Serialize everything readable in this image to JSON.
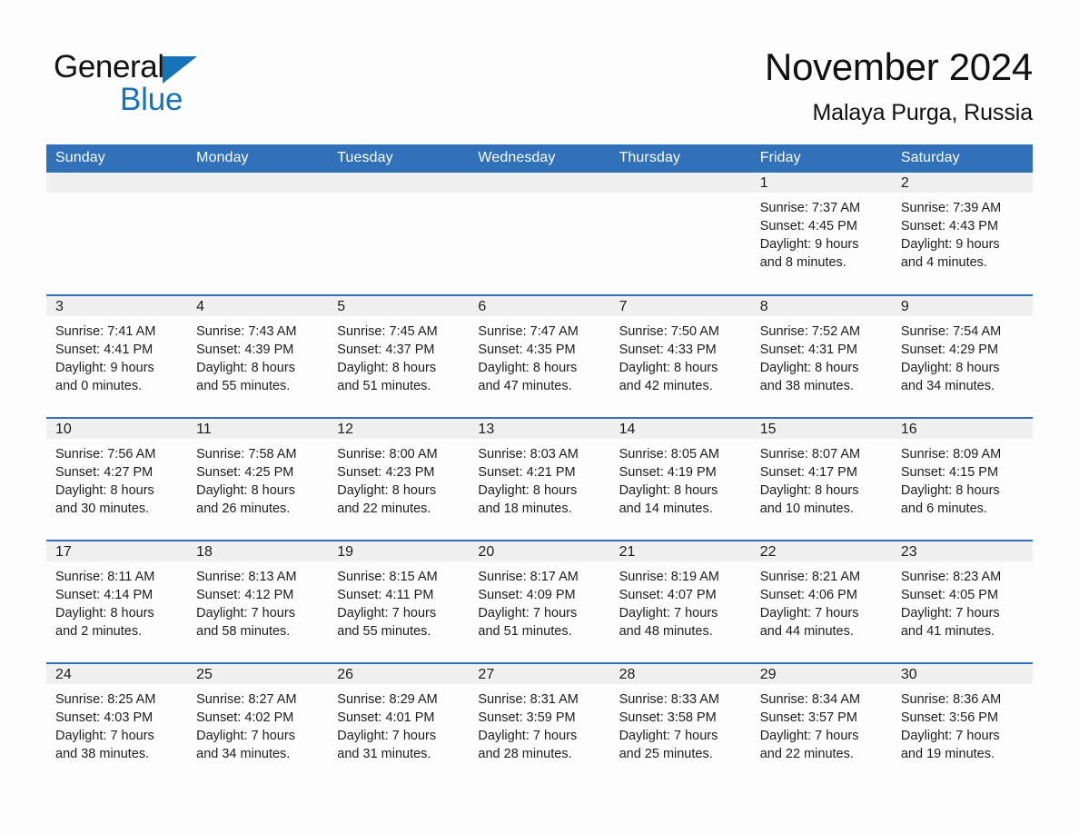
{
  "brand": {
    "name_part1": "General",
    "name_part2": "Blue",
    "triangle_icon": "triangle-icon",
    "accent_color": "#1573ba"
  },
  "header": {
    "title": "November 2024",
    "location": "Malaya Purga, Russia"
  },
  "theme": {
    "header_blue": "#3071b9",
    "daynum_band": "#f0f0f0",
    "page_background": "#fdfdfd",
    "text_color": "#1d1d1d"
  },
  "calendar": {
    "weekday_headers": [
      "Sunday",
      "Monday",
      "Tuesday",
      "Wednesday",
      "Thursday",
      "Friday",
      "Saturday"
    ],
    "weeks": [
      [
        {
          "day": "",
          "sunrise": "",
          "sunset": "",
          "daylight_line1": "",
          "daylight_line2": "",
          "empty": true
        },
        {
          "day": "",
          "sunrise": "",
          "sunset": "",
          "daylight_line1": "",
          "daylight_line2": "",
          "empty": true
        },
        {
          "day": "",
          "sunrise": "",
          "sunset": "",
          "daylight_line1": "",
          "daylight_line2": "",
          "empty": true
        },
        {
          "day": "",
          "sunrise": "",
          "sunset": "",
          "daylight_line1": "",
          "daylight_line2": "",
          "empty": true
        },
        {
          "day": "",
          "sunrise": "",
          "sunset": "",
          "daylight_line1": "",
          "daylight_line2": "",
          "empty": true
        },
        {
          "day": "1",
          "sunrise": "Sunrise: 7:37 AM",
          "sunset": "Sunset: 4:45 PM",
          "daylight_line1": "Daylight: 9 hours",
          "daylight_line2": "and 8 minutes."
        },
        {
          "day": "2",
          "sunrise": "Sunrise: 7:39 AM",
          "sunset": "Sunset: 4:43 PM",
          "daylight_line1": "Daylight: 9 hours",
          "daylight_line2": "and 4 minutes."
        }
      ],
      [
        {
          "day": "3",
          "sunrise": "Sunrise: 7:41 AM",
          "sunset": "Sunset: 4:41 PM",
          "daylight_line1": "Daylight: 9 hours",
          "daylight_line2": "and 0 minutes."
        },
        {
          "day": "4",
          "sunrise": "Sunrise: 7:43 AM",
          "sunset": "Sunset: 4:39 PM",
          "daylight_line1": "Daylight: 8 hours",
          "daylight_line2": "and 55 minutes."
        },
        {
          "day": "5",
          "sunrise": "Sunrise: 7:45 AM",
          "sunset": "Sunset: 4:37 PM",
          "daylight_line1": "Daylight: 8 hours",
          "daylight_line2": "and 51 minutes."
        },
        {
          "day": "6",
          "sunrise": "Sunrise: 7:47 AM",
          "sunset": "Sunset: 4:35 PM",
          "daylight_line1": "Daylight: 8 hours",
          "daylight_line2": "and 47 minutes."
        },
        {
          "day": "7",
          "sunrise": "Sunrise: 7:50 AM",
          "sunset": "Sunset: 4:33 PM",
          "daylight_line1": "Daylight: 8 hours",
          "daylight_line2": "and 42 minutes."
        },
        {
          "day": "8",
          "sunrise": "Sunrise: 7:52 AM",
          "sunset": "Sunset: 4:31 PM",
          "daylight_line1": "Daylight: 8 hours",
          "daylight_line2": "and 38 minutes."
        },
        {
          "day": "9",
          "sunrise": "Sunrise: 7:54 AM",
          "sunset": "Sunset: 4:29 PM",
          "daylight_line1": "Daylight: 8 hours",
          "daylight_line2": "and 34 minutes."
        }
      ],
      [
        {
          "day": "10",
          "sunrise": "Sunrise: 7:56 AM",
          "sunset": "Sunset: 4:27 PM",
          "daylight_line1": "Daylight: 8 hours",
          "daylight_line2": "and 30 minutes."
        },
        {
          "day": "11",
          "sunrise": "Sunrise: 7:58 AM",
          "sunset": "Sunset: 4:25 PM",
          "daylight_line1": "Daylight: 8 hours",
          "daylight_line2": "and 26 minutes."
        },
        {
          "day": "12",
          "sunrise": "Sunrise: 8:00 AM",
          "sunset": "Sunset: 4:23 PM",
          "daylight_line1": "Daylight: 8 hours",
          "daylight_line2": "and 22 minutes."
        },
        {
          "day": "13",
          "sunrise": "Sunrise: 8:03 AM",
          "sunset": "Sunset: 4:21 PM",
          "daylight_line1": "Daylight: 8 hours",
          "daylight_line2": "and 18 minutes."
        },
        {
          "day": "14",
          "sunrise": "Sunrise: 8:05 AM",
          "sunset": "Sunset: 4:19 PM",
          "daylight_line1": "Daylight: 8 hours",
          "daylight_line2": "and 14 minutes."
        },
        {
          "day": "15",
          "sunrise": "Sunrise: 8:07 AM",
          "sunset": "Sunset: 4:17 PM",
          "daylight_line1": "Daylight: 8 hours",
          "daylight_line2": "and 10 minutes."
        },
        {
          "day": "16",
          "sunrise": "Sunrise: 8:09 AM",
          "sunset": "Sunset: 4:15 PM",
          "daylight_line1": "Daylight: 8 hours",
          "daylight_line2": "and 6 minutes."
        }
      ],
      [
        {
          "day": "17",
          "sunrise": "Sunrise: 8:11 AM",
          "sunset": "Sunset: 4:14 PM",
          "daylight_line1": "Daylight: 8 hours",
          "daylight_line2": "and 2 minutes."
        },
        {
          "day": "18",
          "sunrise": "Sunrise: 8:13 AM",
          "sunset": "Sunset: 4:12 PM",
          "daylight_line1": "Daylight: 7 hours",
          "daylight_line2": "and 58 minutes."
        },
        {
          "day": "19",
          "sunrise": "Sunrise: 8:15 AM",
          "sunset": "Sunset: 4:11 PM",
          "daylight_line1": "Daylight: 7 hours",
          "daylight_line2": "and 55 minutes."
        },
        {
          "day": "20",
          "sunrise": "Sunrise: 8:17 AM",
          "sunset": "Sunset: 4:09 PM",
          "daylight_line1": "Daylight: 7 hours",
          "daylight_line2": "and 51 minutes."
        },
        {
          "day": "21",
          "sunrise": "Sunrise: 8:19 AM",
          "sunset": "Sunset: 4:07 PM",
          "daylight_line1": "Daylight: 7 hours",
          "daylight_line2": "and 48 minutes."
        },
        {
          "day": "22",
          "sunrise": "Sunrise: 8:21 AM",
          "sunset": "Sunset: 4:06 PM",
          "daylight_line1": "Daylight: 7 hours",
          "daylight_line2": "and 44 minutes."
        },
        {
          "day": "23",
          "sunrise": "Sunrise: 8:23 AM",
          "sunset": "Sunset: 4:05 PM",
          "daylight_line1": "Daylight: 7 hours",
          "daylight_line2": "and 41 minutes."
        }
      ],
      [
        {
          "day": "24",
          "sunrise": "Sunrise: 8:25 AM",
          "sunset": "Sunset: 4:03 PM",
          "daylight_line1": "Daylight: 7 hours",
          "daylight_line2": "and 38 minutes."
        },
        {
          "day": "25",
          "sunrise": "Sunrise: 8:27 AM",
          "sunset": "Sunset: 4:02 PM",
          "daylight_line1": "Daylight: 7 hours",
          "daylight_line2": "and 34 minutes."
        },
        {
          "day": "26",
          "sunrise": "Sunrise: 8:29 AM",
          "sunset": "Sunset: 4:01 PM",
          "daylight_line1": "Daylight: 7 hours",
          "daylight_line2": "and 31 minutes."
        },
        {
          "day": "27",
          "sunrise": "Sunrise: 8:31 AM",
          "sunset": "Sunset: 3:59 PM",
          "daylight_line1": "Daylight: 7 hours",
          "daylight_line2": "and 28 minutes."
        },
        {
          "day": "28",
          "sunrise": "Sunrise: 8:33 AM",
          "sunset": "Sunset: 3:58 PM",
          "daylight_line1": "Daylight: 7 hours",
          "daylight_line2": "and 25 minutes."
        },
        {
          "day": "29",
          "sunrise": "Sunrise: 8:34 AM",
          "sunset": "Sunset: 3:57 PM",
          "daylight_line1": "Daylight: 7 hours",
          "daylight_line2": "and 22 minutes."
        },
        {
          "day": "30",
          "sunrise": "Sunrise: 8:36 AM",
          "sunset": "Sunset: 3:56 PM",
          "daylight_line1": "Daylight: 7 hours",
          "daylight_line2": "and 19 minutes."
        }
      ]
    ]
  }
}
